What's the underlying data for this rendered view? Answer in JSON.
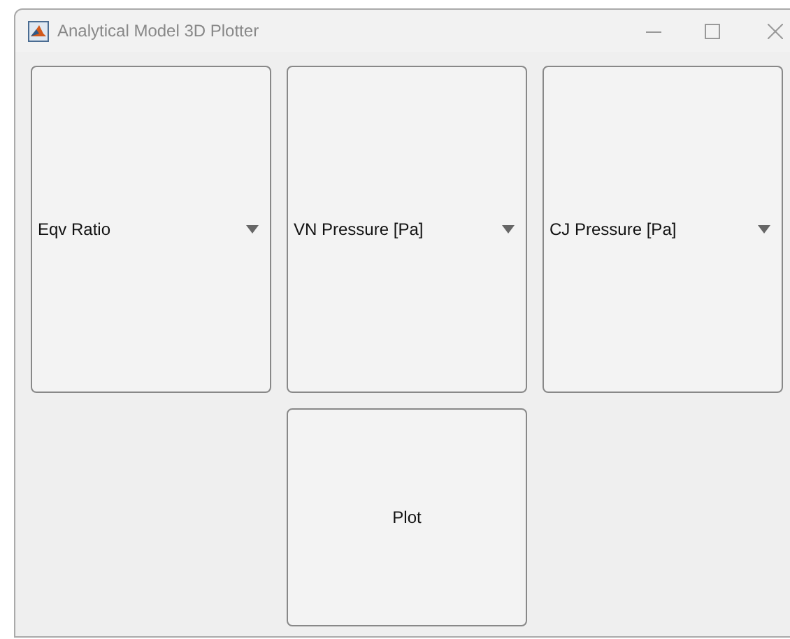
{
  "window": {
    "title": "Analytical Model 3D Plotter"
  },
  "dropdowns": [
    {
      "value": "Eqv Ratio"
    },
    {
      "value": "VN Pressure [Pa]"
    },
    {
      "value": "CJ Pressure [Pa]"
    }
  ],
  "buttons": [
    {
      "label": "Plot"
    }
  ]
}
